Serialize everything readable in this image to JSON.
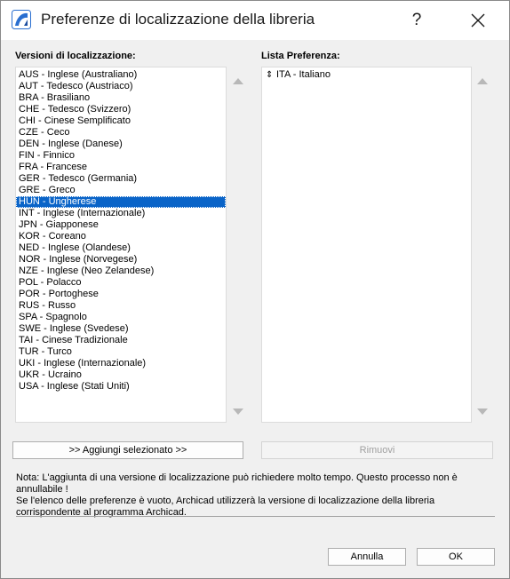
{
  "window": {
    "title": "Preferenze di localizzazione della libreria",
    "help_label": "?",
    "close_icon": "close-icon",
    "app_icon": "archicad-logo-icon"
  },
  "left_panel": {
    "label": "Versioni di localizzazione:",
    "selected_index": 11,
    "items": [
      "AUS - Inglese (Australiano)",
      "AUT - Tedesco (Austriaco)",
      "BRA - Brasiliano",
      "CHE - Tedesco (Svizzero)",
      "CHI - Cinese Semplificato",
      "CZE - Ceco",
      "DEN - Inglese (Danese)",
      "FIN - Finnico",
      "FRA - Francese",
      "GER - Tedesco (Germania)",
      "GRE - Greco",
      "HUN - Ungherese",
      "INT - Inglese (Internazionale)",
      "JPN - Giapponese",
      "KOR - Coreano",
      "NED - Inglese (Olandese)",
      "NOR - Inglese (Norvegese)",
      "NZE - Inglese (Neo Zelandese)",
      "POL - Polacco",
      "POR - Portoghese",
      "RUS - Russo",
      "SPA - Spagnolo",
      "SWE - Inglese (Svedese)",
      "TAI - Cinese Tradizionale",
      "TUR - Turco",
      "UKI - Inglese (Internazionale)",
      "UKR - Ucraino",
      "USA - Inglese (Stati Uniti)"
    ]
  },
  "right_panel": {
    "label": "Lista Preferenza:",
    "items": [
      "ITA - Italiano"
    ],
    "reorder_icon": "up-down-arrows-icon"
  },
  "buttons": {
    "add": ">> Aggiungi selezionato >>",
    "remove": "Rimuovi",
    "cancel": "Annulla",
    "ok": "OK"
  },
  "note": {
    "line1": "Nota: L'aggiunta di una versione di localizzazione può richiedere molto tempo. Questo processo non è annullabile !",
    "line2": "Se l'elenco delle preferenze è vuoto, Archicad utilizzerà la versione di localizzazione della libreria corrispondente al programma Archicad."
  },
  "colors": {
    "selection": "#0a64c8",
    "window_bg": "#f0f0f0",
    "logo_blue": "#2a6fd0"
  }
}
